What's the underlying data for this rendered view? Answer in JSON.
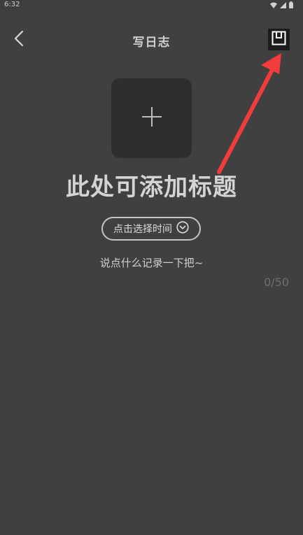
{
  "status_bar": {
    "time": "6:32",
    "icons": [
      "wifi-icon",
      "signal-icon",
      "battery-icon"
    ]
  },
  "header": {
    "back_icon": "chevron-left-icon",
    "title": "写日志",
    "save_icon": "save-icon"
  },
  "cover": {
    "add_icon": "plus-icon"
  },
  "editor": {
    "title_placeholder": "此处可添加标题",
    "time_select_label": "点击选择时间",
    "time_select_icon": "chevron-down-circle-icon",
    "content_placeholder": "说点什么记录一下把~",
    "char_count": "0/50"
  },
  "colors": {
    "background": "#404040",
    "annotation_arrow": "#f23c3c"
  }
}
